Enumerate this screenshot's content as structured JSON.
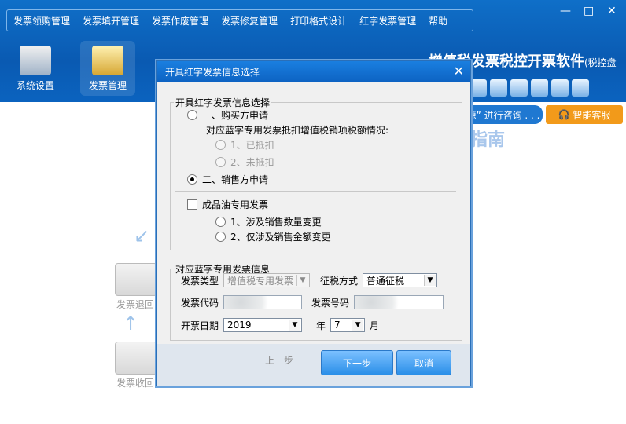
{
  "app": {
    "menu": [
      "发票领购管理",
      "发票填开管理",
      "发票作废管理",
      "发票修复管理",
      "打印格式设计",
      "红字发票管理",
      "帮助"
    ],
    "window_controls": [
      "—",
      "□",
      "✕"
    ],
    "toolbar": [
      "系统设置",
      "发票管理"
    ],
    "brand_title": "增值税发票税控开票软件",
    "brand_sub": "(税控盘版)",
    "banner_text": "源” 进行咨询 . . .",
    "smart_service": "智能客服",
    "bg_text": "指南",
    "flow_labels": [
      "发票退回",
      "发票收回"
    ]
  },
  "dialog": {
    "title": "开具红字发票信息选择",
    "close": "✕",
    "group1_title": "开具红字发票信息选择",
    "opt_buyer": "一、购买方申请",
    "buyer_sub_label": "对应蓝字专用发票抵扣增值税销项税额情况:",
    "deducted": "1、已抵扣",
    "not_deducted": "2、未抵扣",
    "opt_seller": "二、销售方申请",
    "oil_checkbox": "成品油专用发票",
    "oil_opt1": "1、涉及销售数量变更",
    "oil_opt2": "2、仅涉及销售金额变更",
    "group2_title": "对应蓝字专用发票信息",
    "invoice_type_label": "发票类型",
    "invoice_type_value": "增值税专用发票",
    "tax_method_label": "征税方式",
    "tax_method_value": "普通征税",
    "invoice_code_label": "发票代码",
    "invoice_number_label": "发票号码",
    "issue_date_label": "开票日期",
    "year_value": "2019",
    "year_unit": "年",
    "month_value": "7",
    "month_unit": "月",
    "btn_prev": "上一步",
    "btn_next": "下一步",
    "btn_cancel": "取消"
  }
}
